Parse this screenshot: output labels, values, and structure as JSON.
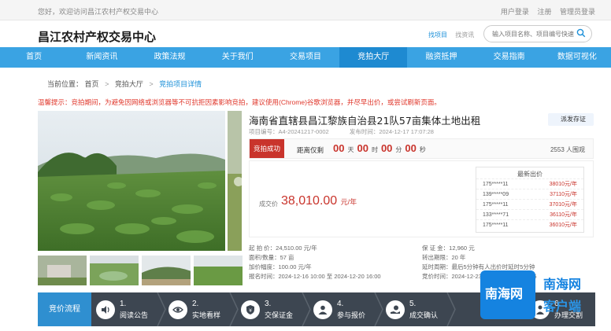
{
  "topbar": {
    "welcome": "您好，欢迎访问昌江农村产权交易中心",
    "login": "用户登录",
    "register": "注册",
    "admin_login": "管理员登录"
  },
  "header": {
    "brand": "昌江农村产权交易中心",
    "link_project": "找项目",
    "link_news": "找资讯",
    "search_placeholder": "输入项目名称、项目编号快速"
  },
  "nav": {
    "items": [
      "首页",
      "新闻资讯",
      "政策法规",
      "关于我们",
      "交易项目",
      "竞拍大厅",
      "融资抵押",
      "交易指南",
      "数据可视化"
    ]
  },
  "breadcrumb": {
    "label": "当前位置：",
    "home": "首页",
    "hall": "竞拍大厅",
    "current": "竞拍项目详情",
    "arrow": ">"
  },
  "notice": "温馨提示：竞拍期间，为避免因网络或浏览器等不可抗拒因素影响竞拍，建议使用(Chrome)谷歌浏览器，并尽早出价，或尝试刷新页面。",
  "project": {
    "title": "海南省直辖县昌江黎族自治县21队57亩集体土地出租",
    "code": "项目编号：A4-20241217-0002",
    "publish": "发布时间：2024-12-17 17:07:28",
    "cert": "派发存证"
  },
  "status": {
    "badge": "竞拍成功",
    "countdown_label": "距离仅剩",
    "days": "00",
    "days_unit": "天",
    "hours": "00",
    "hours_unit": "时",
    "minutes": "00",
    "minutes_unit": "分",
    "seconds": "00",
    "seconds_unit": "秒",
    "viewers": "2553 人围观"
  },
  "deal": {
    "label": "成交价",
    "price": "38,010.00",
    "unit": "元/年"
  },
  "bids": {
    "title": "最新出价",
    "rows": [
      {
        "user": "175*****11",
        "price": "38010元/年"
      },
      {
        "user": "139*****09",
        "price": "37110元/年"
      },
      {
        "user": "175*****11",
        "price": "37010元/年"
      },
      {
        "user": "133*****71",
        "price": "36110元/年"
      },
      {
        "user": "175*****11",
        "price": "36010元/年"
      }
    ]
  },
  "params": {
    "start_price": "起 拍 价：24,510.00 元/年",
    "deposit": "保 证 金：12,960 元",
    "area": "面积/数量：57 亩",
    "term": "转出期限：20 年",
    "increment": "加价幅度：100.00 元/年",
    "delay": "延时周期：最后5分钟有人出价时延时5分钟",
    "signup": "报名时间：2024-12-16 10:00 至 2024-12-20 16:00",
    "auction": "竞价时间：2024-12-23 ... 2024-12-23 16:25"
  },
  "steps": {
    "title": "竞价流程",
    "items": [
      {
        "num": "1.",
        "label": "阅读公告"
      },
      {
        "num": "2.",
        "label": "实地看样"
      },
      {
        "num": "3.",
        "label": "交保证金"
      },
      {
        "num": "4.",
        "label": "参与报价"
      },
      {
        "num": "5.",
        "label": "成交确认"
      },
      {
        "num": "6.",
        "label": "办理交割"
      }
    ]
  },
  "watermark": {
    "main": "南海网",
    "right_top": "南海网",
    "right_bottom": "客户端"
  }
}
